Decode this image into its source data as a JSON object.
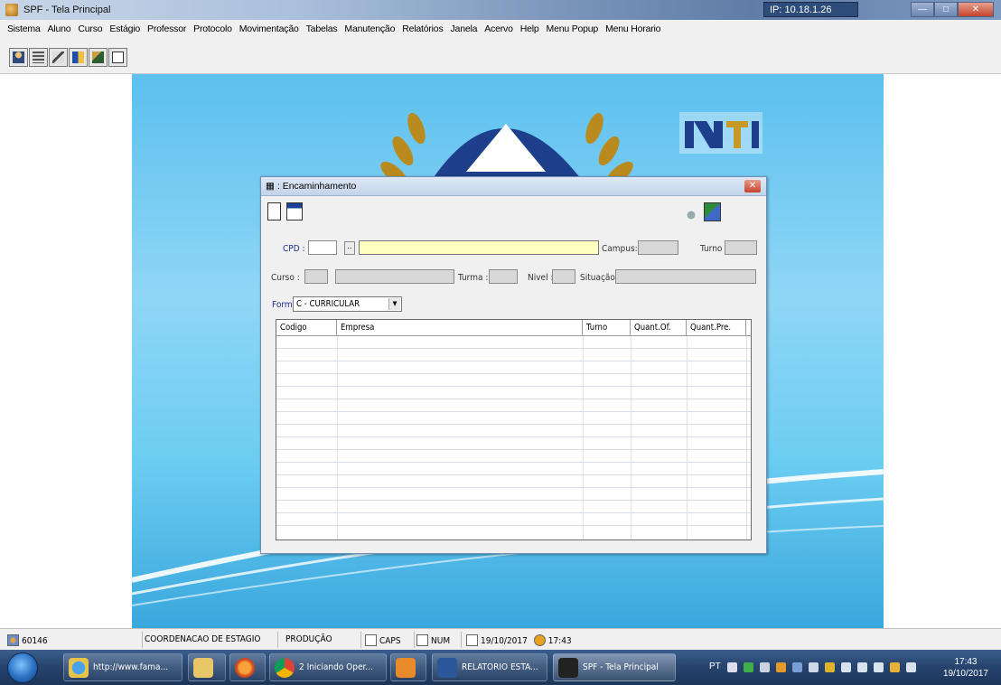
{
  "window": {
    "title": "SPF - Tela Principal",
    "ip": "IP: 10.18.1.26"
  },
  "menu": [
    "Sistema",
    "Aluno",
    "Curso",
    "Estágio",
    "Professor",
    "Protocolo",
    "Movimentação",
    "Tabelas",
    "Manutenção",
    "Relatórios",
    "Janela",
    "Acervo",
    "Help",
    "Menu Popup",
    "Menu Horario"
  ],
  "toolbar_icons": [
    "user-icon",
    "keyboard-icon",
    "tools-icon",
    "grid-icon",
    "report-icon",
    "window-icon"
  ],
  "dialog": {
    "title": "Encaminhamento",
    "labels": {
      "cpd": "CPD :",
      "campus": "Campus:",
      "turno": "Turno",
      "curso": "Curso :",
      "turma": "Turma :",
      "nivel": "Nivel :",
      "situacao": "Situação",
      "forma": "Forma"
    },
    "forma_value": "C - CURRICULAR",
    "grid_columns": [
      "Codigo",
      "Empresa",
      "Turno",
      "Quant.Of.",
      "Quant.Pre."
    ]
  },
  "statusbar": {
    "user_code": "60146",
    "department": "COORDENACAO DE ESTAGIO",
    "environment": "PRODUÇÃO",
    "caps": "CAPS",
    "num": "NUM",
    "date": "19/10/2017",
    "time": "17:43"
  },
  "taskbar": {
    "tasks": [
      "http://www.fama...",
      "2 Iniciando Oper...",
      "RELATORIO ESTA...",
      "SPF - Tela Principal"
    ],
    "language": "PT",
    "clock_time": "17:43",
    "clock_date": "19/10/2017"
  }
}
